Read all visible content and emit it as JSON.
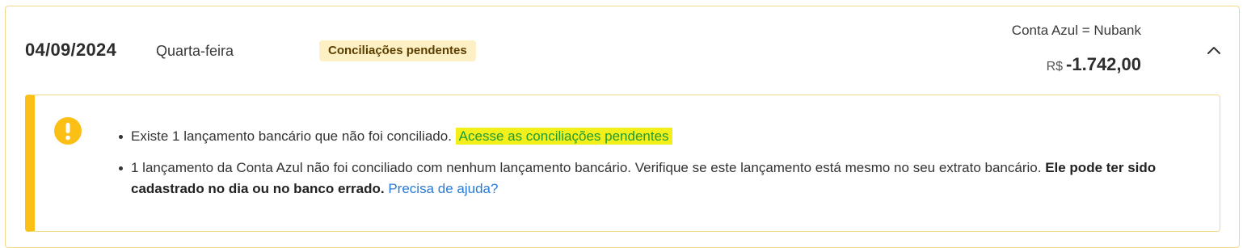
{
  "header": {
    "date": "04/09/2024",
    "weekday": "Quarta-feira",
    "status_badge": "Conciliações pendentes",
    "account_label": "Conta Azul = Nubank",
    "currency": "R$",
    "amount": "-1.742,00",
    "collapse_icon": "chevron-up-icon"
  },
  "alert": {
    "icon": "exclamation-icon",
    "accent_color": "#fbbf15",
    "items": [
      {
        "text": "Existe 1 lançamento bancário que não foi conciliado.",
        "link": "Acesse as conciliações pendentes"
      },
      {
        "text": "1 lançamento da Conta Azul não foi conciliado com nenhum lançamento bancário. Verifique se este lançamento está mesmo no seu extrato bancário.",
        "bold": "Ele pode ter sido cadastrado no dia ou no banco errado.",
        "link": "Precisa de ajuda?"
      }
    ]
  }
}
